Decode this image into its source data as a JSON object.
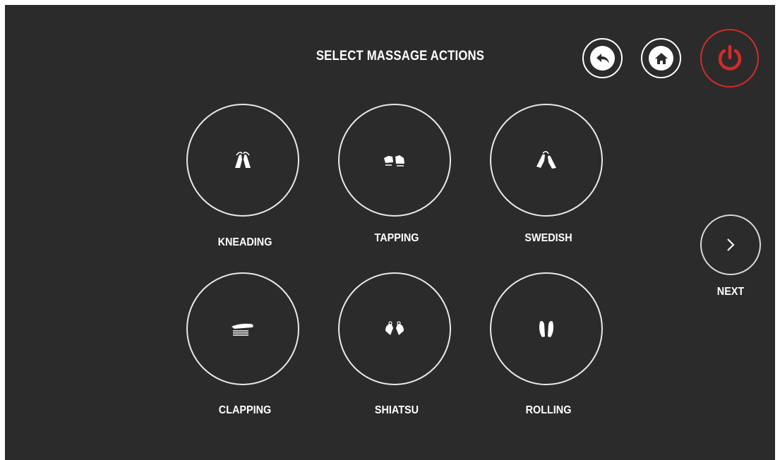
{
  "header": {
    "title": "SELECT MASSAGE ACTIONS",
    "back_icon": "back-arrow-icon",
    "home_icon": "home-icon",
    "power_icon": "power-icon",
    "power_color": "#d42a2a"
  },
  "actions": [
    {
      "label": "KNEADING",
      "icon": "kneading-hands-icon"
    },
    {
      "label": "TAPPING",
      "icon": "tapping-hands-icon"
    },
    {
      "label": "SWEDISH",
      "icon": "swedish-hands-icon"
    },
    {
      "label": "CLAPPING",
      "icon": "clapping-hand-icon"
    },
    {
      "label": "SHIATSU",
      "icon": "shiatsu-hands-icon"
    },
    {
      "label": "ROLLING",
      "icon": "rolling-hands-icon"
    }
  ],
  "navigation": {
    "next_label": "NEXT",
    "next_icon": "chevron-right-icon"
  },
  "colors": {
    "background": "#2b2b2b",
    "foreground": "#ffffff"
  }
}
